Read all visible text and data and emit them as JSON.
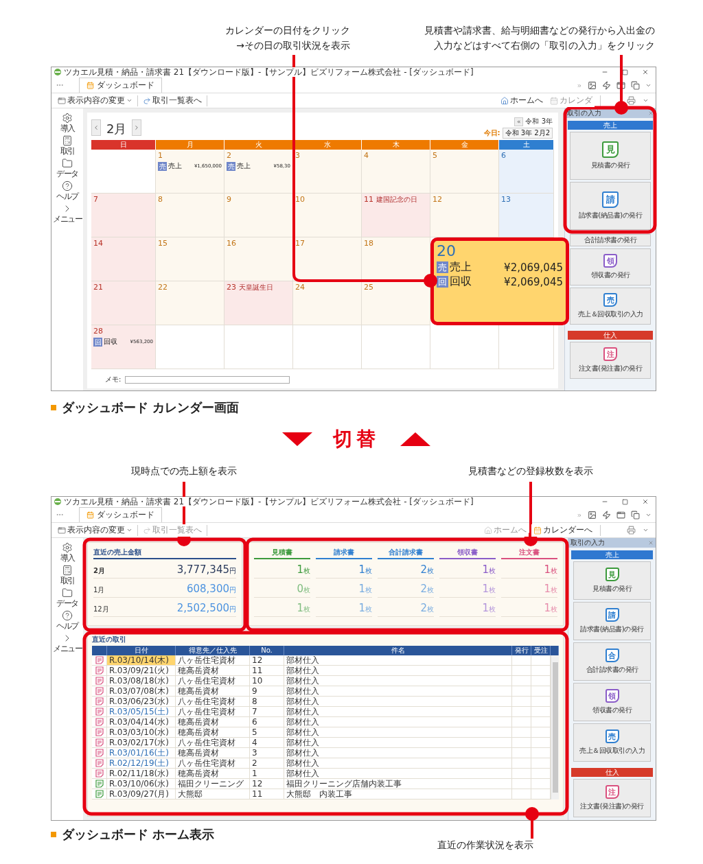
{
  "annotations_top": [
    {
      "lines": [
        "カレンダーの日付をクリック",
        "→その日の取引状況を表示"
      ]
    },
    {
      "lines": [
        "見積書や請求書、給与明細書などの発行から入出金の",
        "入力などはすべて右側の「取引の入力」をクリック"
      ]
    }
  ],
  "calendar_screen": {
    "kind": "calendar",
    "title": "ツカエル見積・納品・請求書 21【ダウンロード版】-【サンプル】ビズリフォーム株式会社 - [ダッシュボード]",
    "tabs": [
      {
        "label": "ダッシュボード",
        "selected": true
      }
    ],
    "toolbar_left": [
      {
        "label": "表示内容の変更",
        "disabled": false
      },
      {
        "label": "取引一覧表へ",
        "disabled": false
      }
    ],
    "toolbar_right": [
      {
        "label": "ホームへ",
        "disabled": false
      },
      {
        "label": "カレンダ",
        "disabled": true
      }
    ],
    "sidebar": [
      {
        "label": "導入"
      },
      {
        "label": "取引"
      },
      {
        "label": "データ"
      },
      {
        "label": "ヘルプ"
      },
      {
        "label": "メニュー"
      }
    ],
    "calendar": {
      "month": "2月",
      "prev_year": "«",
      "era": "令和 3年",
      "today_label": "今日:",
      "today_value": "令和 3年 2月2",
      "weekdays": [
        "日",
        "月",
        "火",
        "水",
        "木",
        "金",
        "土"
      ],
      "weeks": [
        [
          {
            "kind": "empty"
          },
          {
            "kind": "day",
            "date": "1",
            "highlighted": false,
            "entries": [
              {
                "icon": "売",
                "label": "売上",
                "amount": "¥1,650,000"
              }
            ]
          },
          {
            "kind": "day",
            "date": "2",
            "highlighted": false,
            "entries": [
              {
                "icon": "売",
                "label": "売上",
                "amount": "¥58,30"
              }
            ]
          },
          {
            "kind": "day",
            "date": "3",
            "highlighted": false
          },
          {
            "kind": "day",
            "date": "4",
            "highlighted": false
          },
          {
            "kind": "day",
            "date": "5",
            "highlighted": false
          },
          {
            "kind": "day",
            "date": "6",
            "highlighted": false
          }
        ],
        [
          {
            "kind": "day",
            "date": "7",
            "highlighted": false
          },
          {
            "kind": "day",
            "date": "8",
            "highlighted": false
          },
          {
            "kind": "day",
            "date": "9",
            "highlighted": false
          },
          {
            "kind": "day",
            "date": "10",
            "highlighted": false
          },
          {
            "kind": "day",
            "date": "11",
            "highlighted": false,
            "holiday": "建国記念の日"
          },
          {
            "kind": "day",
            "date": "12",
            "highlighted": false
          },
          {
            "kind": "day",
            "date": "13",
            "highlighted": false
          }
        ],
        [
          {
            "kind": "day",
            "date": "14",
            "highlighted": false
          },
          {
            "kind": "day",
            "date": "15",
            "highlighted": false
          },
          {
            "kind": "day",
            "date": "16",
            "highlighted": false
          },
          {
            "kind": "day",
            "date": "17",
            "highlighted": false
          },
          {
            "kind": "day",
            "date": "18",
            "highlighted": false
          },
          {
            "kind": "empty"
          },
          {
            "kind": "day",
            "date": "20",
            "highlighted": true,
            "entries": [
              {
                "icon": "売",
                "label": "売上",
                "amount": "¥2,069,045"
              },
              {
                "icon": "回",
                "label": "回収",
                "amount": "¥2,069,045"
              }
            ]
          }
        ],
        [
          {
            "kind": "day",
            "date": "21",
            "highlighted": false
          },
          {
            "kind": "day",
            "date": "22",
            "highlighted": false
          },
          {
            "kind": "day",
            "date": "23",
            "highlighted": false,
            "holiday": "天皇誕生日"
          },
          {
            "kind": "day",
            "date": "24",
            "highlighted": false
          },
          {
            "kind": "day",
            "date": "25",
            "highlighted": false
          },
          {
            "kind": "empty"
          },
          {
            "kind": "empty"
          }
        ],
        [
          {
            "kind": "day",
            "date": "28",
            "highlighted": false,
            "entries": [
              {
                "icon": "回",
                "label": "回収",
                "amount": "¥563,200"
              }
            ]
          },
          {
            "kind": "empty"
          },
          {
            "kind": "empty"
          },
          {
            "kind": "empty"
          },
          {
            "kind": "empty"
          },
          {
            "kind": "empty"
          },
          {
            "kind": "empty"
          }
        ]
      ],
      "memo_label": "メモ:"
    },
    "panel": {
      "title": "取引の入力",
      "sections": [
        {
          "label": "売上",
          "kind": "sales",
          "buttons": [
            {
              "label": "見積書の発行",
              "icon": "見",
              "color": "#3c9a3c"
            },
            {
              "label": "請求書(納品書)の発行",
              "icon": "請",
              "color": "#2f7fd0"
            },
            {
              "label": "合計請求書の発行"
            },
            {
              "label": "領収書の発行",
              "icon": "領",
              "color": "#8a5cc8"
            },
            {
              "label": "売上＆回収取引の入力",
              "icon": "売",
              "color": "#2f7fd0"
            }
          ]
        },
        {
          "label": "仕入",
          "kind": "purchase",
          "buttons": [
            {
              "label": "注文書(発注書)の発行",
              "icon": "注",
              "color": "#d9507e"
            }
          ]
        }
      ]
    }
  },
  "caption_calendar": "ダッシュボード カレンダー画面",
  "switch_label": "切替",
  "annotations_middle": [
    {
      "text": "現時点での売上額を表示"
    },
    {
      "text": "見積書などの登録枚数を表示"
    }
  ],
  "home_screen": {
    "kind": "home",
    "title": "ツカエル見積・納品・請求書 21【ダウンロード版】-【サンプル】ビズリフォーム株式会社 - [ダッシュボード]",
    "tabs": [
      {
        "label": "ダッシュボード",
        "selected": true
      }
    ],
    "toolbar_left": [
      {
        "label": "表示内容の変更",
        "disabled": false
      },
      {
        "label": "取引一覧表へ",
        "disabled": true
      }
    ],
    "toolbar_right": [
      {
        "label": "ホームへ",
        "disabled": true
      },
      {
        "label": "カレンダーへ",
        "disabled": false
      }
    ],
    "sidebar": [
      {
        "label": "導入"
      },
      {
        "label": "取引"
      },
      {
        "label": "データ"
      },
      {
        "label": "ヘルプ"
      },
      {
        "label": "メニュー"
      }
    ],
    "sales_summary": {
      "title": "直近の売上金額",
      "rows": [
        {
          "month": "2月",
          "amount": "3,777,345",
          "unit": "円",
          "current": true
        },
        {
          "month": "1月",
          "amount": "608,300",
          "unit": "円",
          "current": false
        },
        {
          "month": "12月",
          "amount": "2,502,500",
          "unit": "円",
          "current": false
        }
      ]
    },
    "document_counts": {
      "columns": [
        {
          "label": "見積書",
          "color": "#3c9a3c"
        },
        {
          "label": "請求書",
          "color": "#2f7fd0"
        },
        {
          "label": "合計請求書",
          "color": "#2f7fd0"
        },
        {
          "label": "領収書",
          "color": "#8a5cc8"
        },
        {
          "label": "注文書",
          "color": "#d9507e"
        }
      ],
      "rows": [
        {
          "current": true,
          "cells": [
            {
              "value": "1",
              "unit": "枚"
            },
            {
              "value": "1",
              "unit": "枚"
            },
            {
              "value": "2",
              "unit": "枚"
            },
            {
              "value": "1",
              "unit": "枚"
            },
            {
              "value": "1",
              "unit": "枚"
            }
          ]
        },
        {
          "current": false,
          "cells": [
            {
              "value": "0",
              "unit": "枚"
            },
            {
              "value": "1",
              "unit": "枚"
            },
            {
              "value": "2",
              "unit": "枚"
            },
            {
              "value": "1",
              "unit": "枚"
            },
            {
              "value": "1",
              "unit": "枚"
            }
          ]
        },
        {
          "current": false,
          "cells": [
            {
              "value": "1",
              "unit": "枚"
            },
            {
              "value": "1",
              "unit": "枚"
            },
            {
              "value": "2",
              "unit": "枚"
            },
            {
              "value": "1",
              "unit": "枚"
            },
            {
              "value": "1",
              "unit": "枚"
            }
          ]
        }
      ]
    },
    "recent_transactions": {
      "title": "直近の取引",
      "columns": [
        "日付",
        "得意先／仕入先",
        "No.",
        "件名",
        "発行",
        "受注"
      ],
      "rows": [
        {
          "kind": "purchase",
          "date": "R.03/10/14(木)",
          "partner": "八ヶ岳住宅資材",
          "no": "12",
          "subject": "部材仕入",
          "selected": true,
          "saturday": false
        },
        {
          "kind": "purchase",
          "date": "R.03/09/21(火)",
          "partner": "穂高岳資材",
          "no": "11",
          "subject": "部材仕入",
          "selected": false,
          "saturday": false
        },
        {
          "kind": "purchase",
          "date": "R.03/08/18(水)",
          "partner": "八ヶ岳住宅資材",
          "no": "10",
          "subject": "部材仕入",
          "selected": false,
          "saturday": false
        },
        {
          "kind": "purchase",
          "date": "R.03/07/08(木)",
          "partner": "穂高岳資材",
          "no": "9",
          "subject": "部材仕入",
          "selected": false,
          "saturday": false
        },
        {
          "kind": "purchase",
          "date": "R.03/06/23(水)",
          "partner": "八ヶ岳住宅資材",
          "no": "8",
          "subject": "部材仕入",
          "selected": false,
          "saturday": false
        },
        {
          "kind": "purchase",
          "date": "R.03/05/15(土)",
          "partner": "八ヶ岳住宅資材",
          "no": "7",
          "subject": "部材仕入",
          "selected": false,
          "saturday": true
        },
        {
          "kind": "purchase",
          "date": "R.03/04/14(水)",
          "partner": "穂高岳資材",
          "no": "6",
          "subject": "部材仕入",
          "selected": false,
          "saturday": false
        },
        {
          "kind": "purchase",
          "date": "R.03/03/10(水)",
          "partner": "穂高岳資材",
          "no": "5",
          "subject": "部材仕入",
          "selected": false,
          "saturday": false
        },
        {
          "kind": "purchase",
          "date": "R.03/02/17(水)",
          "partner": "八ヶ岳住宅資材",
          "no": "4",
          "subject": "部材仕入",
          "selected": false,
          "saturday": false
        },
        {
          "kind": "purchase",
          "date": "R.03/01/16(土)",
          "partner": "穂高岳資材",
          "no": "3",
          "subject": "部材仕入",
          "selected": false,
          "saturday": true
        },
        {
          "kind": "purchase",
          "date": "R.02/12/19(土)",
          "partner": "八ヶ岳住宅資材",
          "no": "2",
          "subject": "部材仕入",
          "selected": false,
          "saturday": true
        },
        {
          "kind": "purchase",
          "date": "R.02/11/18(水)",
          "partner": "穂高岳資材",
          "no": "1",
          "subject": "部材仕入",
          "selected": false,
          "saturday": false
        },
        {
          "kind": "estimate",
          "date": "R.03/10/06(水)",
          "partner": "福田クリーニング",
          "no": "12",
          "subject": "福田クリーニング店舗内装工事",
          "selected": false,
          "saturday": false
        },
        {
          "kind": "estimate",
          "date": "R.03/09/27(月)",
          "partner": "大熊邸",
          "no": "11",
          "subject": "大熊邸　内装工事",
          "selected": false,
          "saturday": false
        }
      ]
    },
    "panel": {
      "title": "取引の入力",
      "sections": [
        {
          "label": "売上",
          "kind": "sales",
          "buttons": [
            {
              "label": "見積書の発行",
              "icon": "見",
              "color": "#3c9a3c"
            },
            {
              "label": "請求書(納品書)の発行",
              "icon": "請",
              "color": "#2f7fd0"
            },
            {
              "label": "合計請求書の発行",
              "icon": "合",
              "color": "#2f7fd0"
            },
            {
              "label": "領収書の発行",
              "icon": "領",
              "color": "#8a5cc8"
            },
            {
              "label": "売上＆回収取引の入力",
              "icon": "売",
              "color": "#2f7fd0"
            }
          ]
        },
        {
          "label": "仕入",
          "kind": "purchase",
          "buttons": [
            {
              "label": "注文書(発注書)の発行",
              "icon": "注",
              "color": "#d9507e"
            }
          ]
        }
      ]
    }
  },
  "caption_home": "ダッシュボード ホーム表示",
  "annotation_bottom": "直近の作業状況を表示"
}
